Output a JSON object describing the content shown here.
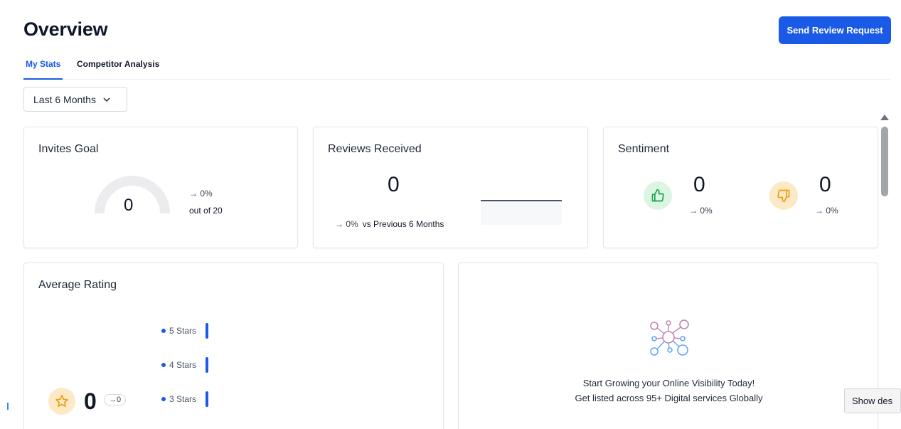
{
  "header": {
    "title": "Overview",
    "primary_action": "Send Review Request"
  },
  "tabs": [
    {
      "label": "My Stats",
      "active": true
    },
    {
      "label": "Competitor Analysis",
      "active": false
    }
  ],
  "filter": {
    "range": "Last 6 Months"
  },
  "invites_goal": {
    "title": "Invites Goal",
    "value": "0",
    "change": "→ 0%",
    "out_of": "out of 20"
  },
  "reviews_received": {
    "title": "Reviews Received",
    "value": "0",
    "change": "→ 0%",
    "comparison": "vs Previous 6 Months"
  },
  "sentiment": {
    "title": "Sentiment",
    "positive_value": "0",
    "positive_change": "→ 0%",
    "negative_value": "0",
    "negative_change": "→ 0%"
  },
  "average_rating": {
    "title": "Average Rating",
    "value": "0",
    "delta": "→0",
    "rows": [
      {
        "label": "5 Stars"
      },
      {
        "label": "4 Stars"
      },
      {
        "label": "3 Stars"
      }
    ]
  },
  "promo": {
    "line1": "Start Growing your Online Visibility Today!",
    "line2": "Get listed across 95+ Digital services Globally"
  },
  "tooltip": {
    "text": "Show des"
  },
  "colors": {
    "accent": "#1a5ae6",
    "positive_bg": "#dcf5e3",
    "warning_bg": "#fde9c6"
  }
}
